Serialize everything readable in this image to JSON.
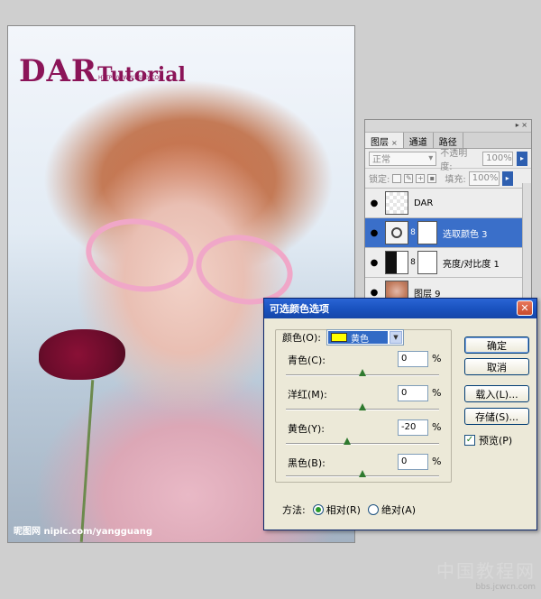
{
  "canvas": {
    "logo_big": "DAR",
    "logo_small": "Tutorial",
    "logo_url": "HTTP://WWW.PSFLY.COM",
    "watermark_left": "昵图网 nipic.com/yangguang"
  },
  "layers_panel": {
    "tabs": [
      {
        "label": "图层",
        "active": true
      },
      {
        "label": "通道",
        "active": false
      },
      {
        "label": "路径",
        "active": false
      }
    ],
    "blend_mode": "正常",
    "opacity_label": "不透明度:",
    "opacity_value": "100%",
    "lock_label": "锁定:",
    "fill_label": "填充:",
    "fill_value": "100%",
    "layers": [
      {
        "name": "DAR",
        "thumb": "checker",
        "selected": false
      },
      {
        "name": "选取颜色 3",
        "thumb": "adjustment",
        "selected": true
      },
      {
        "name": "亮度/对比度 1",
        "thumb": "contrast",
        "selected": false
      },
      {
        "name": "图层 9",
        "thumb": "photo",
        "selected": false
      }
    ]
  },
  "dialog": {
    "title": "可选颜色选项",
    "color_label": "颜色(O):",
    "color_value": "黄色",
    "color_swatch": "#ffff00",
    "sliders": [
      {
        "label": "青色(C):",
        "value": "0",
        "unit": "%"
      },
      {
        "label": "洋红(M):",
        "value": "0",
        "unit": "%"
      },
      {
        "label": "黄色(Y):",
        "value": "-20",
        "unit": "%"
      },
      {
        "label": "黑色(B):",
        "value": "0",
        "unit": "%"
      }
    ],
    "buttons": {
      "ok": "确定",
      "cancel": "取消",
      "load": "载入(L)...",
      "save": "存储(S)..."
    },
    "preview_label": "预览(P)",
    "preview_checked": true,
    "method_label": "方法:",
    "method_relative": "相对(R)",
    "method_absolute": "绝对(A)",
    "method_selected": "relative"
  },
  "watermark_right": {
    "cn": "中国教程网",
    "url": "bbs.jcwcn.com"
  }
}
